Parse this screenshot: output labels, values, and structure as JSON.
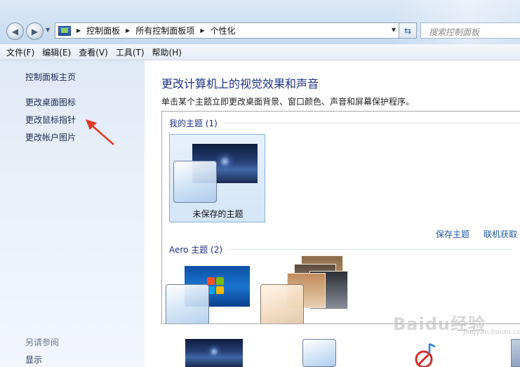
{
  "address": {
    "crumbs": [
      "控制面板",
      "所有控制面板项",
      "个性化"
    ],
    "search_placeholder": "搜索控制面板"
  },
  "menu": [
    "文件(F)",
    "编辑(E)",
    "查看(V)",
    "工具(T)",
    "帮助(H)"
  ],
  "sidebar": {
    "home": "控制面板主页",
    "links": [
      "更改桌面图标",
      "更改鼠标指针",
      "更改帐户图片"
    ],
    "see_also": "另请参阅",
    "see_also_links": [
      "显示"
    ]
  },
  "main": {
    "heading": "更改计算机上的视觉效果和声音",
    "subtitle": "单击某个主题立即更改桌面背景、窗口颜色、声音和屏幕保护程序。",
    "my_themes": {
      "title": "我的主题 (1)",
      "items": [
        {
          "label": "未保存的主题",
          "selected": true
        }
      ]
    },
    "actions": [
      "保存主题",
      "联机获取"
    ],
    "aero_themes": {
      "title": "Aero 主题 (2)"
    }
  },
  "watermark": {
    "brand": "Baidu经验",
    "url": "jingyan.baidu.com"
  },
  "colors": {
    "link": "#1f5ba8",
    "heading": "#1e3287",
    "annotation_arrow": "#e23a2a"
  },
  "icons": [
    "back-arrow-icon",
    "forward-arrow-icon",
    "control-panel-icon",
    "refresh-icon",
    "chevron-down-icon"
  ]
}
